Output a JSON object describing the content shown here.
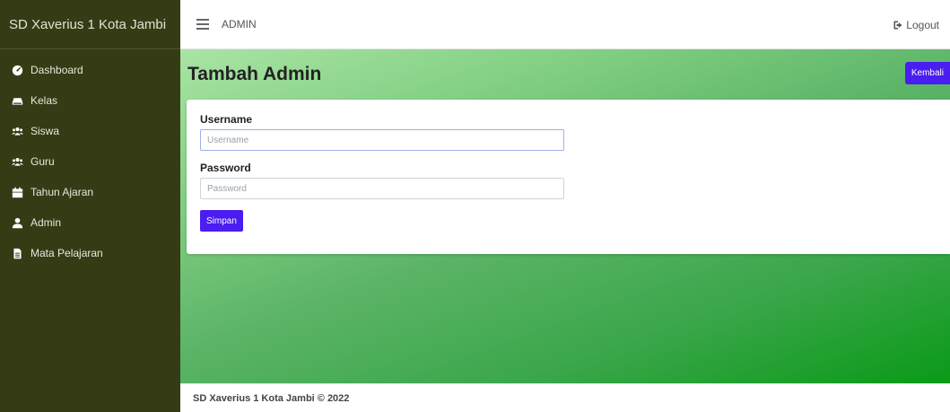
{
  "sidebar": {
    "brand": "SD Xaverius 1 Kota Jambi",
    "items": [
      {
        "label": "Dashboard",
        "icon": "dashboard-icon"
      },
      {
        "label": "Kelas",
        "icon": "hdd-icon"
      },
      {
        "label": "Siswa",
        "icon": "users-icon"
      },
      {
        "label": "Guru",
        "icon": "users-icon"
      },
      {
        "label": "Tahun Ajaran",
        "icon": "calendar-icon"
      },
      {
        "label": "Admin",
        "icon": "user-icon"
      },
      {
        "label": "Mata Pelajaran",
        "icon": "file-icon"
      }
    ]
  },
  "topbar": {
    "title": "ADMIN",
    "logout_label": "Logout"
  },
  "main": {
    "page_title": "Tambah Admin",
    "back_label": "Kembali"
  },
  "form": {
    "username_label": "Username",
    "username_placeholder": "Username",
    "password_label": "Password",
    "password_placeholder": "Password",
    "save_label": "Simpan"
  },
  "footer": {
    "text": "SD Xaverius 1 Kota Jambi © 2022"
  },
  "colors": {
    "sidebar_bg": "#353c15",
    "accent": "#4a1df0",
    "gradient_start": "#a9e4a4",
    "gradient_end": "#0a9a17"
  }
}
